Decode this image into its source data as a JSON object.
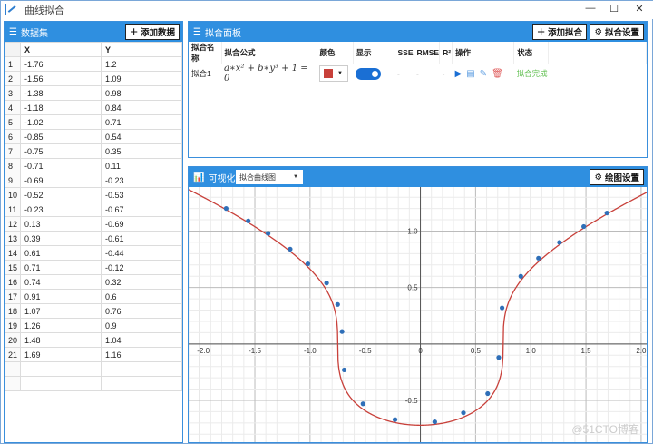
{
  "window": {
    "title": "曲线拟合",
    "min": "—",
    "max": "☐",
    "close": "✕"
  },
  "dataset": {
    "title": "数据集",
    "add_button": "添加数据",
    "columns": [
      "X",
      "Y"
    ],
    "rows": [
      [
        "-1.76",
        "1.2"
      ],
      [
        "-1.56",
        "1.09"
      ],
      [
        "-1.38",
        "0.98"
      ],
      [
        "-1.18",
        "0.84"
      ],
      [
        "-1.02",
        "0.71"
      ],
      [
        "-0.85",
        "0.54"
      ],
      [
        "-0.75",
        "0.35"
      ],
      [
        "-0.71",
        "0.11"
      ],
      [
        "-0.69",
        "-0.23"
      ],
      [
        "-0.52",
        "-0.53"
      ],
      [
        "-0.23",
        "-0.67"
      ],
      [
        "0.13",
        "-0.69"
      ],
      [
        "0.39",
        "-0.61"
      ],
      [
        "0.61",
        "-0.44"
      ],
      [
        "0.71",
        "-0.12"
      ],
      [
        "0.74",
        "0.32"
      ],
      [
        "0.91",
        "0.6"
      ],
      [
        "1.07",
        "0.76"
      ],
      [
        "1.26",
        "0.9"
      ],
      [
        "1.48",
        "1.04"
      ],
      [
        "1.69",
        "1.16"
      ]
    ]
  },
  "fit_panel": {
    "title": "拟合面板",
    "add_button": "添加拟合",
    "settings_button": "拟合设置",
    "columns": [
      "拟合名称",
      "拟合公式",
      "颜色",
      "显示",
      "SSE",
      "RMSE",
      "R²",
      "操作",
      "状态"
    ],
    "rows": [
      {
        "name": "拟合1",
        "formula": "a∗x² + b∗y³ + 1 = 0",
        "color": "#c8403a",
        "visible": true,
        "sse": "-",
        "rmse": "-",
        "r2": "-",
        "status": "拟合完成"
      }
    ]
  },
  "visual": {
    "title": "可视化",
    "plot_type": "拟合曲线图",
    "settings_button": "绘图设置"
  },
  "watermark": "@51CTO博客",
  "chart_data": {
    "type": "scatter",
    "xlim": [
      -2.1,
      2.05
    ],
    "ylim": [
      -0.87,
      1.39
    ],
    "xticks": [
      "-2.0",
      "-1.5",
      "-1.0",
      "-0.5",
      "0",
      "0.5",
      "1.0",
      "1.5",
      "2.0"
    ],
    "yticks": [
      "1.0",
      "0.5",
      "-0.5"
    ],
    "fit_color": "#c8403a",
    "point_color": "#2f6fb8"
  }
}
